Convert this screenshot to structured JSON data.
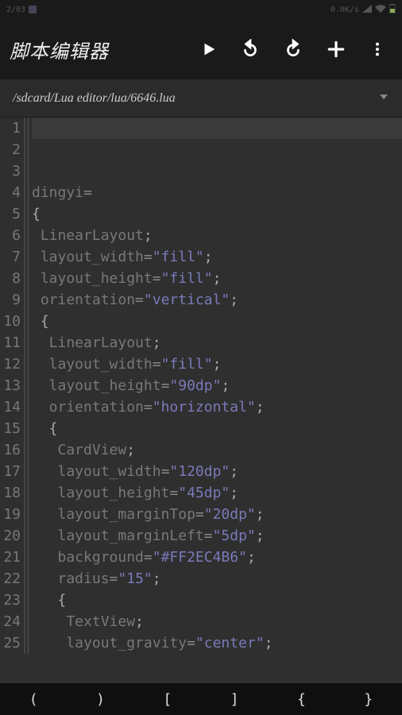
{
  "status_bar": {
    "time": "2/03",
    "speed": "0.0K/s"
  },
  "toolbar": {
    "title": "脚本编辑器"
  },
  "path": {
    "text": "/sdcard/Lua editor/lua/6646.lua"
  },
  "code": {
    "lines": [
      {
        "n": 1,
        "segs": [],
        "current": true
      },
      {
        "n": 2,
        "segs": []
      },
      {
        "n": 3,
        "segs": []
      },
      {
        "n": 4,
        "segs": [
          {
            "t": "dingyi",
            "c": "tok-id"
          },
          {
            "t": "=",
            "c": "tok-op"
          }
        ]
      },
      {
        "n": 5,
        "segs": [
          {
            "t": "{",
            "c": "tok-punc"
          }
        ]
      },
      {
        "n": 6,
        "segs": [
          {
            "t": " LinearLayout",
            "c": "tok-id"
          },
          {
            "t": ";",
            "c": "tok-punc"
          }
        ]
      },
      {
        "n": 7,
        "segs": [
          {
            "t": " layout_width",
            "c": "tok-id"
          },
          {
            "t": "=",
            "c": "tok-op"
          },
          {
            "t": "\"fill\"",
            "c": "tok-str"
          },
          {
            "t": ";",
            "c": "tok-punc"
          }
        ]
      },
      {
        "n": 8,
        "segs": [
          {
            "t": " layout_height",
            "c": "tok-id"
          },
          {
            "t": "=",
            "c": "tok-op"
          },
          {
            "t": "\"fill\"",
            "c": "tok-str"
          },
          {
            "t": ";",
            "c": "tok-punc"
          }
        ]
      },
      {
        "n": 9,
        "segs": [
          {
            "t": " orientation",
            "c": "tok-id"
          },
          {
            "t": "=",
            "c": "tok-op"
          },
          {
            "t": "\"vertical\"",
            "c": "tok-str"
          },
          {
            "t": ";",
            "c": "tok-punc"
          }
        ]
      },
      {
        "n": 10,
        "segs": [
          {
            "t": " {",
            "c": "tok-punc"
          }
        ]
      },
      {
        "n": 11,
        "segs": [
          {
            "t": "  LinearLayout",
            "c": "tok-id"
          },
          {
            "t": ";",
            "c": "tok-punc"
          }
        ]
      },
      {
        "n": 12,
        "segs": [
          {
            "t": "  layout_width",
            "c": "tok-id"
          },
          {
            "t": "=",
            "c": "tok-op"
          },
          {
            "t": "\"fill\"",
            "c": "tok-str"
          },
          {
            "t": ";",
            "c": "tok-punc"
          }
        ]
      },
      {
        "n": 13,
        "segs": [
          {
            "t": "  layout_height",
            "c": "tok-id"
          },
          {
            "t": "=",
            "c": "tok-op"
          },
          {
            "t": "\"90dp\"",
            "c": "tok-str"
          },
          {
            "t": ";",
            "c": "tok-punc"
          }
        ]
      },
      {
        "n": 14,
        "segs": [
          {
            "t": "  orientation",
            "c": "tok-id"
          },
          {
            "t": "=",
            "c": "tok-op"
          },
          {
            "t": "\"horizontal\"",
            "c": "tok-str"
          },
          {
            "t": ";",
            "c": "tok-punc"
          }
        ]
      },
      {
        "n": 15,
        "segs": [
          {
            "t": "  {",
            "c": "tok-punc"
          }
        ]
      },
      {
        "n": 16,
        "segs": [
          {
            "t": "   CardView",
            "c": "tok-id"
          },
          {
            "t": ";",
            "c": "tok-punc"
          }
        ]
      },
      {
        "n": 17,
        "segs": [
          {
            "t": "   layout_width",
            "c": "tok-id"
          },
          {
            "t": "=",
            "c": "tok-op"
          },
          {
            "t": "\"120dp\"",
            "c": "tok-str"
          },
          {
            "t": ";",
            "c": "tok-punc"
          }
        ]
      },
      {
        "n": 18,
        "segs": [
          {
            "t": "   layout_height",
            "c": "tok-id"
          },
          {
            "t": "=",
            "c": "tok-op"
          },
          {
            "t": "\"45dp\"",
            "c": "tok-str"
          },
          {
            "t": ";",
            "c": "tok-punc"
          }
        ]
      },
      {
        "n": 19,
        "segs": [
          {
            "t": "   layout_marginTop",
            "c": "tok-id"
          },
          {
            "t": "=",
            "c": "tok-op"
          },
          {
            "t": "\"20dp\"",
            "c": "tok-str"
          },
          {
            "t": ";",
            "c": "tok-punc"
          }
        ]
      },
      {
        "n": 20,
        "segs": [
          {
            "t": "   layout_marginLeft",
            "c": "tok-id"
          },
          {
            "t": "=",
            "c": "tok-op"
          },
          {
            "t": "\"5dp\"",
            "c": "tok-str"
          },
          {
            "t": ";",
            "c": "tok-punc"
          }
        ]
      },
      {
        "n": 21,
        "segs": [
          {
            "t": "   background",
            "c": "tok-id"
          },
          {
            "t": "=",
            "c": "tok-op"
          },
          {
            "t": "\"#FF2EC4B6\"",
            "c": "tok-str"
          },
          {
            "t": ";",
            "c": "tok-punc"
          }
        ]
      },
      {
        "n": 22,
        "segs": [
          {
            "t": "   radius",
            "c": "tok-id"
          },
          {
            "t": "=",
            "c": "tok-op"
          },
          {
            "t": "\"15\"",
            "c": "tok-str"
          },
          {
            "t": ";",
            "c": "tok-punc"
          }
        ]
      },
      {
        "n": 23,
        "segs": [
          {
            "t": "   {",
            "c": "tok-punc"
          }
        ]
      },
      {
        "n": 24,
        "segs": [
          {
            "t": "    TextView",
            "c": "tok-id"
          },
          {
            "t": ";",
            "c": "tok-punc"
          }
        ]
      },
      {
        "n": 25,
        "segs": [
          {
            "t": "    layout_gravity",
            "c": "tok-id"
          },
          {
            "t": "=",
            "c": "tok-op"
          },
          {
            "t": "\"center\"",
            "c": "tok-str"
          },
          {
            "t": ";",
            "c": "tok-punc"
          }
        ]
      }
    ]
  },
  "keyboard": {
    "keys": [
      "(",
      ")",
      "[",
      "]",
      "{",
      "}"
    ]
  }
}
